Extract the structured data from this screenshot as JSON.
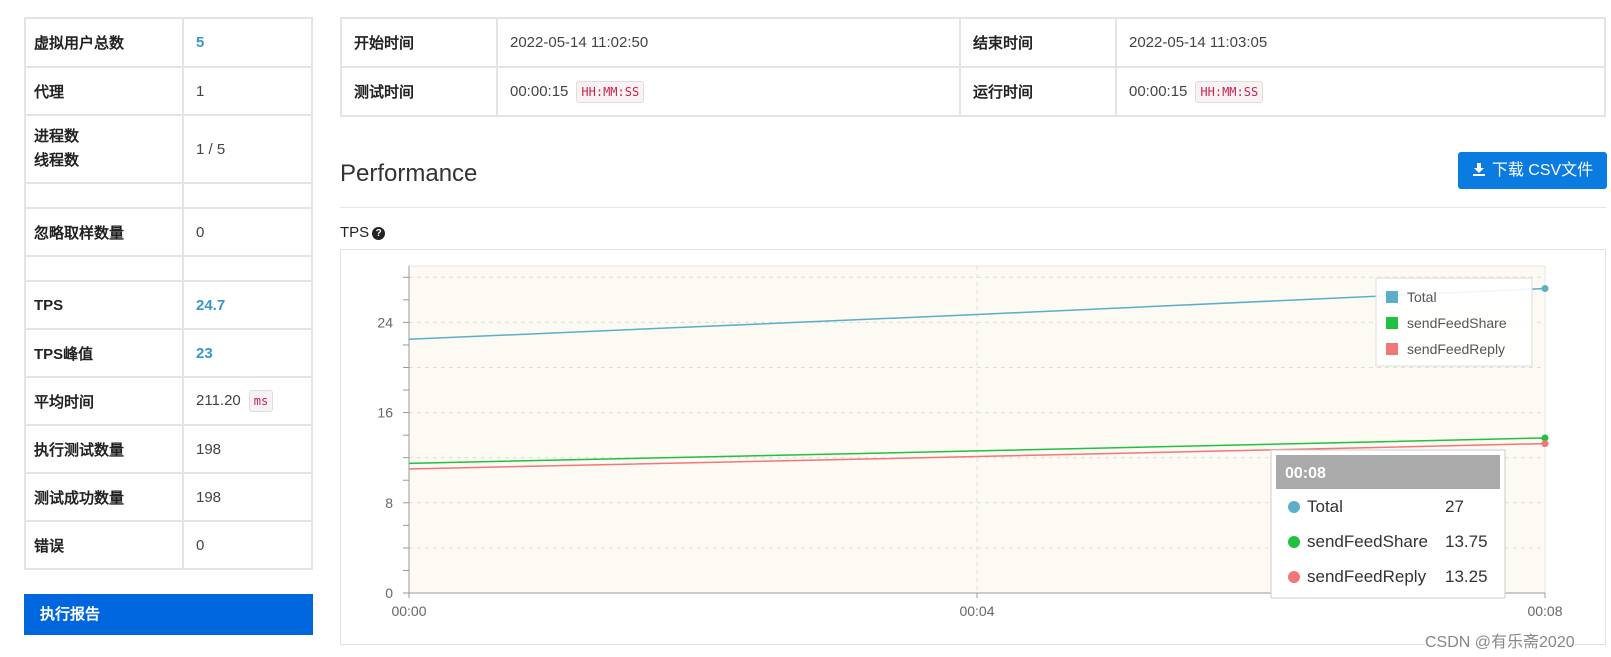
{
  "stats": {
    "rows": [
      {
        "label": "虚拟用户总数",
        "value": "5",
        "highlight": true
      },
      {
        "label": "代理",
        "value": "1"
      },
      {
        "label": "进程数",
        "label2": "线程数",
        "value": "1 / 5"
      },
      {
        "label": "忽略取样数量",
        "value": "0"
      },
      {
        "label": "TPS",
        "value": "24.7",
        "highlight": true
      },
      {
        "label": "TPS峰值",
        "value": "23",
        "highlight": true
      },
      {
        "label": "平均时间",
        "value": "211.20",
        "unit": "ms"
      },
      {
        "label": "执行测试数量",
        "value": "198"
      },
      {
        "label": "测试成功数量",
        "value": "198"
      },
      {
        "label": "错误",
        "value": "0"
      }
    ]
  },
  "report_button": "执行报告",
  "times": {
    "start_label": "开始时间",
    "start_value": "2022-05-14 11:02:50",
    "end_label": "结束时间",
    "end_value": "2022-05-14 11:03:05",
    "test_label": "测试时间",
    "test_value": "00:00:15",
    "test_format": "HH:MM:SS",
    "run_label": "运行时间",
    "run_value": "00:00:15",
    "run_format": "HH:MM:SS"
  },
  "performance_title": "Performance",
  "csv_button": "下载 CSV文件",
  "tps_label": "TPS",
  "watermark": "CSDN @有乐斋2020",
  "chart_data": {
    "type": "line",
    "x": [
      "00:00",
      "00:04",
      "00:08"
    ],
    "xticks": [
      "00:00",
      "00:04",
      "00:08"
    ],
    "ylim": [
      0,
      29
    ],
    "yticks": [
      0,
      8,
      16,
      24
    ],
    "grid": true,
    "legend_position": "top-right",
    "series": [
      {
        "name": "Total",
        "values": [
          22.5,
          24.7,
          27
        ],
        "color": "#5aaec7"
      },
      {
        "name": "sendFeedShare",
        "values": [
          11.5,
          12.6,
          13.75
        ],
        "color": "#22c040"
      },
      {
        "name": "sendFeedReply",
        "values": [
          11.0,
          12.1,
          13.25
        ],
        "color": "#f07878"
      }
    ],
    "tooltip": {
      "title": "00:08",
      "rows": [
        {
          "name": "Total",
          "value": "27"
        },
        {
          "name": "sendFeedShare",
          "value": "13.75"
        },
        {
          "name": "sendFeedReply",
          "value": "13.25"
        }
      ]
    }
  }
}
